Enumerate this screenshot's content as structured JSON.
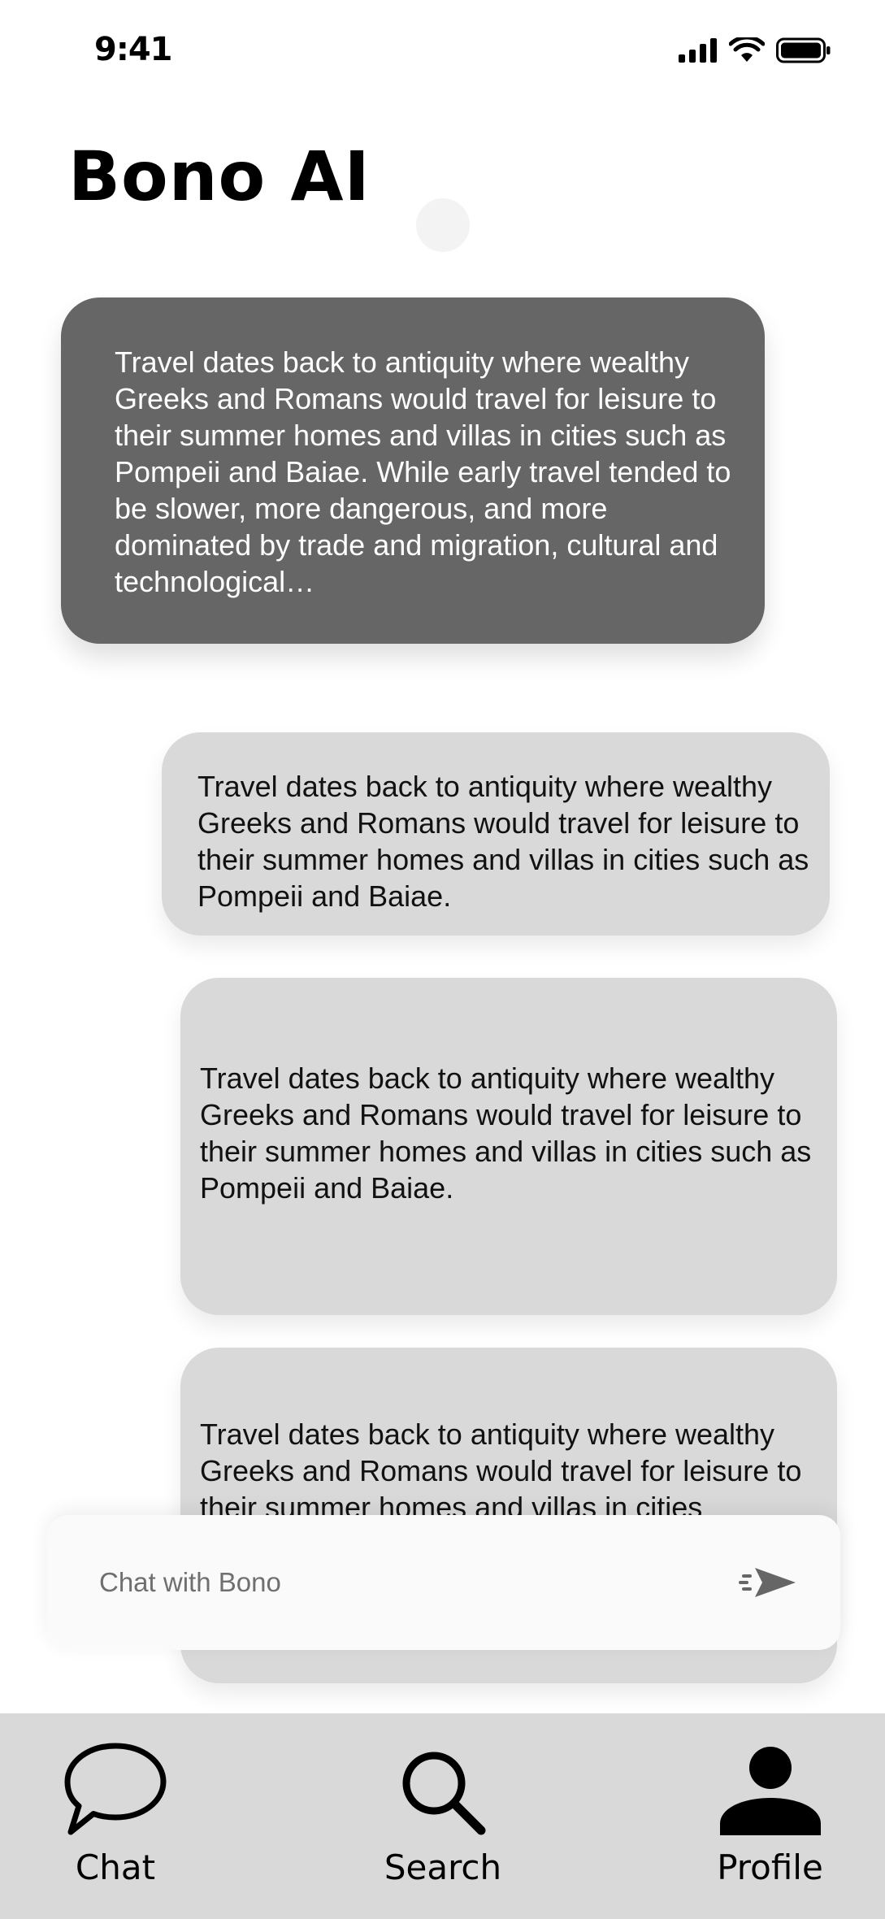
{
  "status_bar": {
    "time": "9:41"
  },
  "header": {
    "title": "Bono AI"
  },
  "messages": [
    {
      "role": "assistant",
      "text": "Travel dates back to antiquity where wealthy Greeks and Romans would travel for leisure to their summer homes and villas in cities such as Pompeii and Baiae. While early travel tended to be slower, more dangerous, and more dominated by trade and migration, cultural and technological…"
    },
    {
      "role": "user",
      "text": "Travel dates back to antiquity where wealthy Greeks and Romans would travel for leisure to their summer homes and villas in cities such as Pompeii and Baiae."
    },
    {
      "role": "user",
      "text": "Travel dates back to antiquity where wealthy Greeks and Romans would travel for leisure to their summer homes and villas in cities such as Pompeii and Baiae."
    },
    {
      "role": "user",
      "text": "Travel dates back to antiquity where wealthy Greeks and Romans would travel for leisure to their summer homes and villas in cities"
    }
  ],
  "chat_input": {
    "placeholder": "Chat with Bono",
    "value": "",
    "send_icon": "send-icon"
  },
  "tab_bar": {
    "tabs": [
      {
        "label": "Chat",
        "icon": "chat-bubble-icon"
      },
      {
        "label": "Search",
        "icon": "search-icon"
      },
      {
        "label": "Profile",
        "icon": "person-icon"
      }
    ]
  },
  "colors": {
    "assistant_bubble": "#666666",
    "user_bubble": "#d9d9d9",
    "tab_bar": "#d9d9d9",
    "input_bar": "#fafafa"
  }
}
